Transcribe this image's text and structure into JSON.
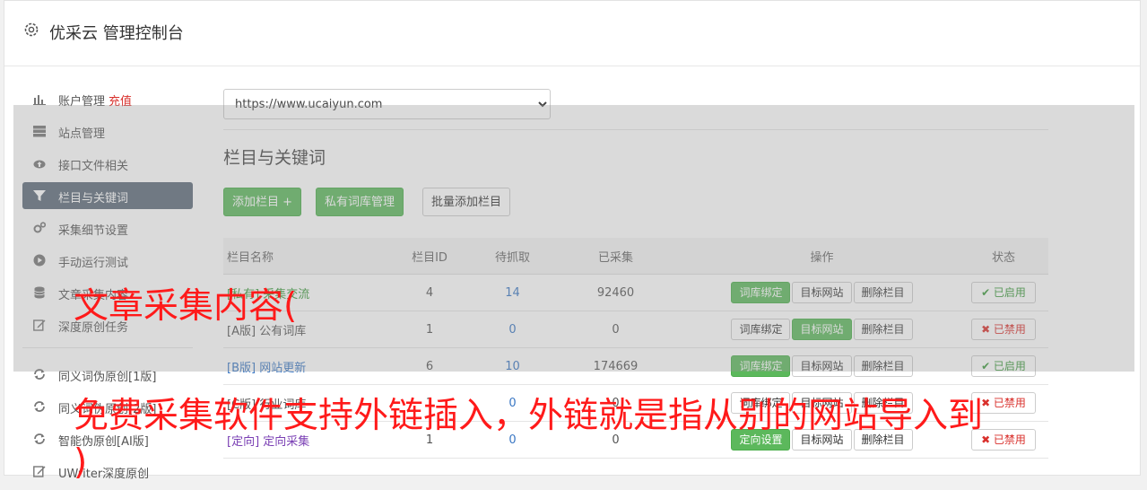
{
  "app": {
    "title": "优采云 管理控制台",
    "icon": "gear-icon"
  },
  "sidebar": {
    "items": [
      {
        "label": "账户管理",
        "extra": "充值",
        "icon": "bar-chart-icon"
      },
      {
        "label": "站点管理",
        "icon": "server-icon"
      },
      {
        "label": "接口文件相关",
        "icon": "cloud-upload-icon"
      },
      {
        "label": "栏目与关键词",
        "icon": "filter-icon",
        "active": true
      },
      {
        "label": "采集细节设置",
        "icon": "gears-icon"
      },
      {
        "label": "手动运行测试",
        "icon": "play-circle-icon"
      },
      {
        "label": "文章采集内容",
        "icon": "database-icon"
      },
      {
        "label": "深度原创任务",
        "icon": "edit-icon"
      }
    ],
    "items2": [
      {
        "label": "同义词伪原创[1版]",
        "icon": "refresh-icon"
      },
      {
        "label": "同义词伪原创[2版]",
        "icon": "refresh-icon"
      },
      {
        "label": "智能伪原创[AI版]",
        "icon": "refresh-icon"
      },
      {
        "label": "UWriter深度原创",
        "icon": "edit-icon"
      }
    ]
  },
  "main": {
    "site_select": {
      "value": "https://www.ucaiyun.com",
      "options": [
        "https://www.ucaiyun.com"
      ]
    },
    "section_title": "栏目与关键词",
    "buttons": {
      "add": "添加栏目 +",
      "private_lib": "私有词库管理",
      "batch_add": "批量添加栏目"
    },
    "table": {
      "headers": {
        "name": "栏目名称",
        "id": "栏目ID",
        "pending": "待抓取",
        "collected": "已采集",
        "ops": "操作",
        "status": "状态"
      },
      "op_labels": {
        "bind": "词库绑定",
        "target": "目标网站",
        "delete": "删除栏目",
        "direct": "定向设置"
      },
      "rows": [
        {
          "tag": "[私有]",
          "name": "采集交流",
          "id": "4",
          "pending": "14",
          "collected": "92460",
          "status": "✔ 已启用"
        },
        {
          "tag": "[A版]",
          "name": "公有词库",
          "id": "1",
          "pending": "0",
          "collected": "0",
          "status": "✖ 已禁用"
        },
        {
          "tag": "[B版]",
          "name": "网站更新",
          "id": "6",
          "pending": "10",
          "collected": "174669",
          "status": "✔ 已启用"
        },
        {
          "tag": "[C版]",
          "name": "行业词库",
          "id": "1",
          "pending": "0",
          "collected": "0",
          "status": "✖ 已禁用"
        },
        {
          "tag": "[定向]",
          "name": "定向采集",
          "id": "1",
          "pending": "0",
          "collected": "0",
          "status": "✖ 已禁用"
        }
      ]
    }
  },
  "overlay_text": {
    "line1": "文章采集内容(",
    "line2": "免费采集软件支持外链插入，外链就是指从别的网站导入到",
    "line3": ")"
  },
  "colors": {
    "accent_green": "#5cb85c",
    "active_nav": "#5d6b7a",
    "red_text": "#ff1a1a",
    "link_blue": "#3a77c4"
  }
}
